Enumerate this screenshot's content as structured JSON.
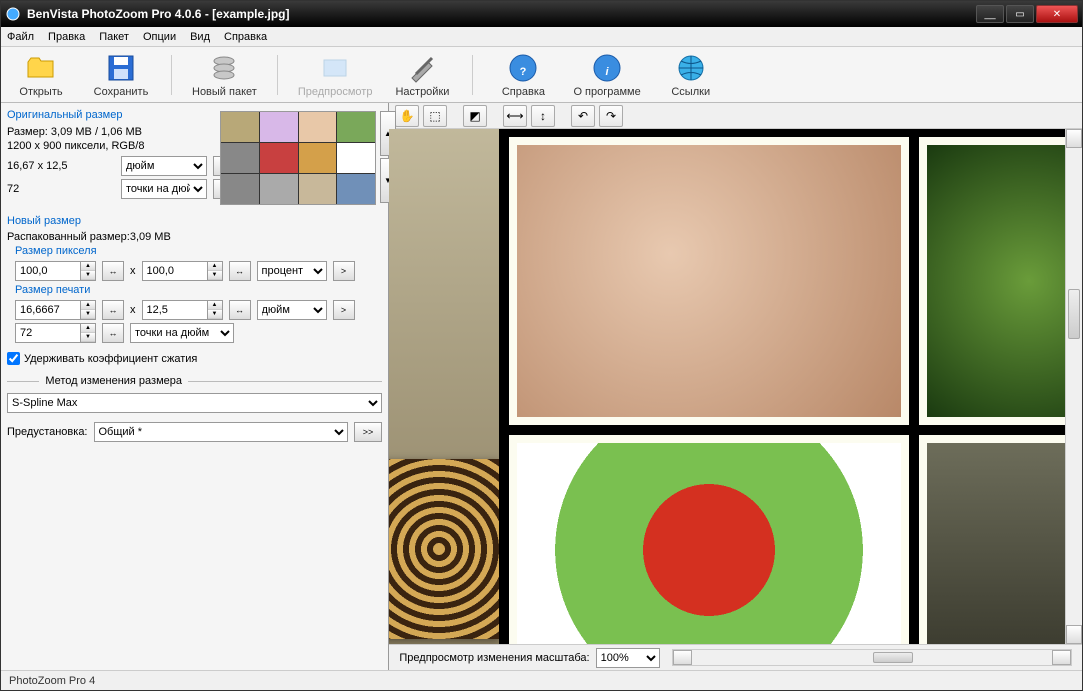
{
  "title": "BenVista PhotoZoom Pro 4.0.6 - [example.jpg]",
  "menu": {
    "file": "Файл",
    "edit": "Правка",
    "batch": "Пакет",
    "options": "Опции",
    "view": "Вид",
    "help": "Справка"
  },
  "toolbar": {
    "open": "Открыть",
    "save": "Сохранить",
    "new_batch": "Новый пакет",
    "preview": "Предпросмотр",
    "settings": "Настройки",
    "help_btn": "Справка",
    "about": "О программе",
    "links": "Ссылки"
  },
  "original": {
    "title": "Оригинальный размер",
    "size_line": "Размер: 3,09 МВ / 1,06 МВ",
    "dimensions": "1200 x 900 пиксели, RGB/8",
    "print_w": "16,67 x 12,5",
    "unit1": "дюйм",
    "res": "72",
    "unit2": "точки на дюйм"
  },
  "newsize": {
    "title": "Новый размер",
    "unpacked": "Распакованный размер:3,09 МВ",
    "pixel_title": "Размер пикселя",
    "pw": "100,0",
    "ph": "100,0",
    "punit": "процент",
    "print_title": "Размер печати",
    "prw": "16,6667",
    "prh": "12,5",
    "prunit": "дюйм",
    "res": "72",
    "resunit": "точки на дюйм",
    "keep_ratio": "Удерживать коэффициент сжатия"
  },
  "resize": {
    "title": "Метод изменения размера",
    "method": "S-Spline Max",
    "preset_label": "Предустановка:",
    "preset": "Общий *",
    "more": ">>"
  },
  "preview_footer": {
    "label": "Предпросмотр изменения масштаба:",
    "zoom": "100%"
  },
  "status": "PhotoZoom Pro 4",
  "x_symbol": "x"
}
